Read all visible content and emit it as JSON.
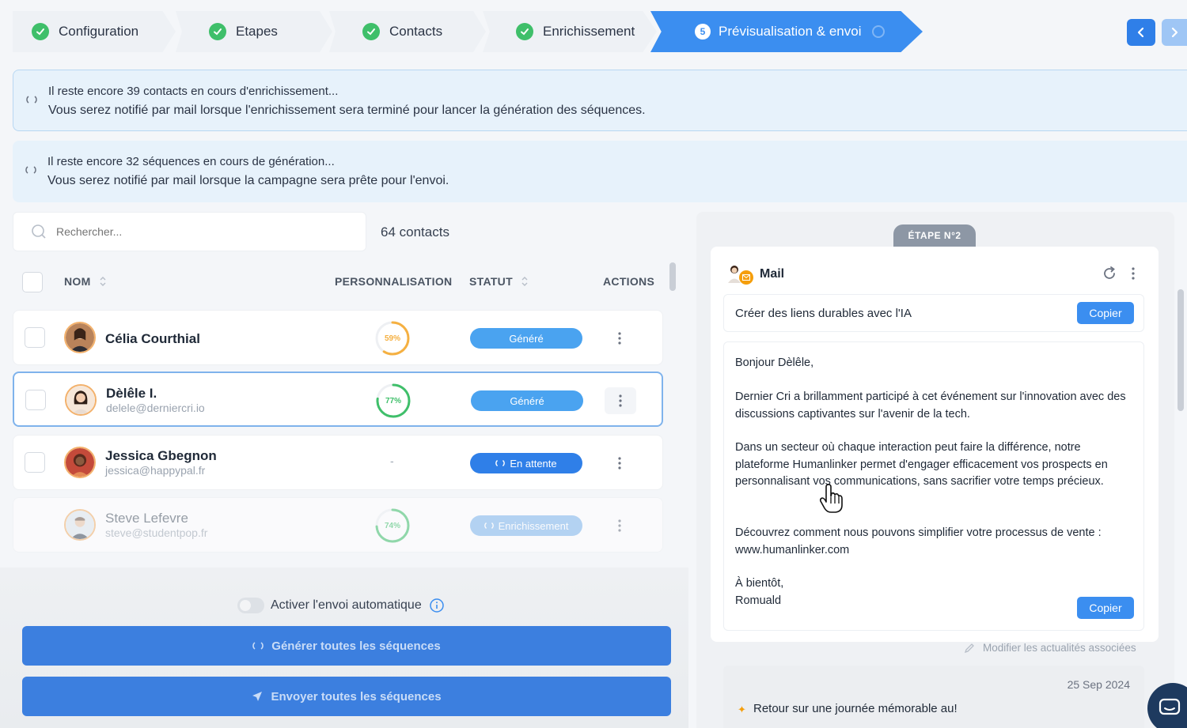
{
  "stepper": {
    "steps": [
      {
        "label": "Configuration",
        "state": "done"
      },
      {
        "label": "Etapes",
        "state": "done"
      },
      {
        "label": "Contacts",
        "state": "done"
      },
      {
        "label": "Enrichissement",
        "state": "done"
      },
      {
        "label": "Prévisualisation & envoi",
        "state": "active",
        "number": "5"
      }
    ]
  },
  "banners": {
    "enrichment": {
      "line1": "Il reste encore 39 contacts en cours d'enrichissement...",
      "line2": "Vous serez notifié par mail lorsque l'enrichissement sera terminé pour lancer la génération des séquences."
    },
    "generation": {
      "line1": "Il reste encore 32 séquences en cours de génération...",
      "line2": "Vous serez notifié par mail lorsque la campagne sera prête pour l'envoi."
    }
  },
  "search": {
    "placeholder": "Rechercher..."
  },
  "contacts_count": "64 contacts",
  "table": {
    "headers": {
      "name": "NOM",
      "personalization": "PERSONNALISATION",
      "status": "STATUT",
      "actions": "ACTIONS"
    },
    "rows": [
      {
        "name": "Célia Courthial",
        "email": "",
        "personalization": "59%",
        "progress": 0.59,
        "status": "Généré"
      },
      {
        "name": "Dèlêle I.",
        "email": "delele@derniercri.io",
        "personalization": "77%",
        "progress": 0.77,
        "status": "Généré"
      },
      {
        "name": "Jessica Gbegnon",
        "email": "jessica@happypal.fr",
        "personalization": "-",
        "progress": 0,
        "status": "En attente"
      },
      {
        "name": "Steve Lefevre",
        "email": "steve@studentpop.fr",
        "personalization": "74%",
        "progress": 0.74,
        "status": "Enrichissement"
      }
    ]
  },
  "auto_send": {
    "label": "Activer l'envoi automatique",
    "enabled": false
  },
  "buttons": {
    "generate_all": "Générer toutes les séquences",
    "send_all": "Envoyer toutes les séquences"
  },
  "preview": {
    "stage": "ÉTAPE N°2",
    "channel": "Mail",
    "subject": "Créer des liens durables avec l'IA",
    "copy_label": "Copier",
    "body": {
      "greeting": "Bonjour Dèlêle,",
      "p1": "Dernier Cri a brillamment participé à cet événement sur l'innovation avec des discussions captivantes sur l'avenir de la tech.",
      "p2": "Dans un secteur où chaque interaction peut faire la différence, notre plateforme Humanlinker permet d'engager efficacement vos prospects en personnalisant vos communications, sans sacrifier votre temps précieux.",
      "p3": "Découvrez comment nous pouvons simplifier votre processus de vente : www.humanlinker.com",
      "closing": "À bientôt,",
      "signature": "Romuald"
    },
    "modify_news": "Modifier les actualités associées",
    "news": {
      "date": "25 Sep 2024",
      "title": "Retour sur une journée mémorable au!"
    }
  },
  "colors": {
    "accent": "#3b8ef0",
    "success": "#3fbf6a",
    "warning": "#f5b041"
  }
}
